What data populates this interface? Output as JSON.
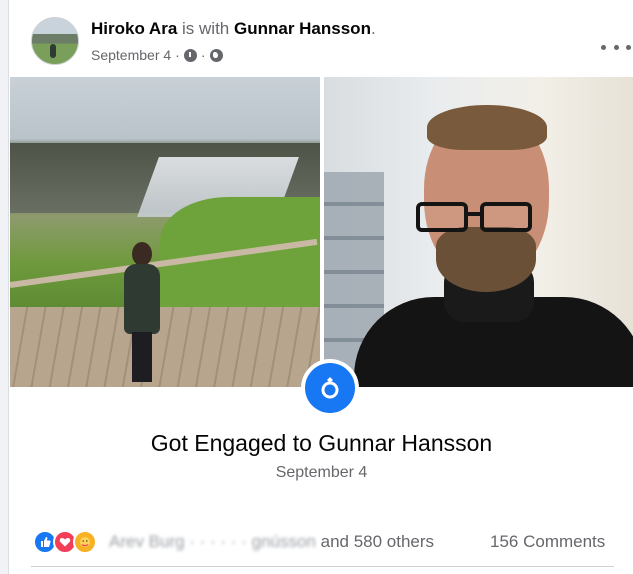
{
  "post": {
    "author": "Hiroko Ara",
    "with_text": "is with",
    "tagged": "Gunnar Hansson",
    "period": ".",
    "date": "September 4",
    "separator": "·"
  },
  "event": {
    "title": "Got Engaged to Gunnar Hansson",
    "date": "September 4"
  },
  "footer": {
    "reaction_names_obscured": "Arev Burg · · ·  ·  ·  · gnússon",
    "reaction_suffix": " and 580 others",
    "comments": "156 Comments"
  },
  "colors": {
    "accent": "#1877f2",
    "secondary_text": "#65676b",
    "love": "#f33e58",
    "care": "#f7b125"
  }
}
